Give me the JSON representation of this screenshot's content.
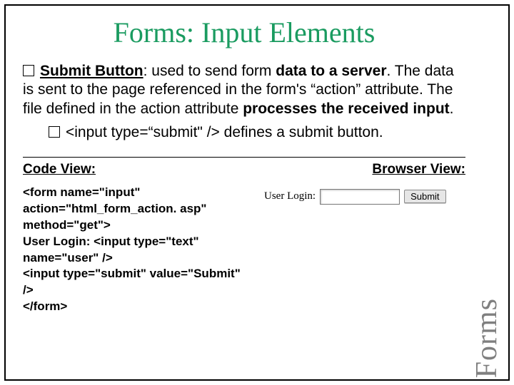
{
  "title": "Forms: Input Elements",
  "bullet_glyph": "",
  "para": {
    "lead": "Submit Button",
    "seg1": ": used to send form ",
    "bold1": "data to a server",
    "seg2": ". The data is sent to the page referenced in the form's “action” attribute. The file defined in the action attribute ",
    "bold2": "processes the received input",
    "seg3": "."
  },
  "subline": "<input type=“submit\" /> defines a submit button.",
  "labels": {
    "code": "Code View:",
    "browser": "Browser View:"
  },
  "code": "<form name=\"input\"\naction=\"html_form_action. asp\"\nmethod=\"get\">\nUser Login: <input type=\"text\"\nname=\"user\" />\n<input type=\"submit\" value=\"Submit\" />\n</form>",
  "demo": {
    "label": "User Login:",
    "button": "Submit"
  },
  "side_label": "Forms"
}
